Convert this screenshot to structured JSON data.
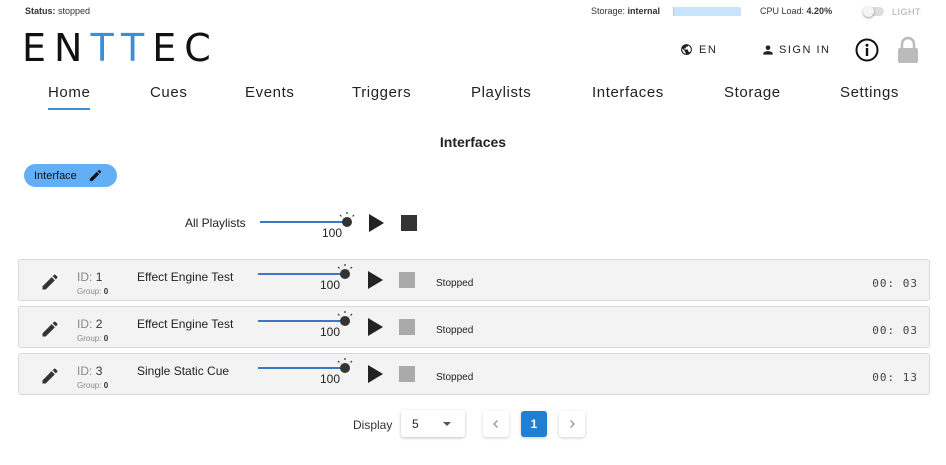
{
  "topbar": {
    "status_label": "Status:",
    "status_value": "stopped",
    "storage_label": "Storage:",
    "storage_value": "internal",
    "storage_used_fraction": 0.02,
    "cpu_label": "CPU Load:",
    "cpu_value": "4.20%",
    "theme_label": "LIGHT"
  },
  "header": {
    "logo_part1": "EN",
    "logo_part2": "TT",
    "logo_part3": "EC",
    "lang_label": "EN",
    "signin_label": "SIGN IN",
    "icons": [
      "globe-icon",
      "person-icon",
      "info-icon",
      "lock-icon"
    ]
  },
  "nav": {
    "tabs": [
      {
        "label": "Home",
        "active": true
      },
      {
        "label": "Cues"
      },
      {
        "label": "Events"
      },
      {
        "label": "Triggers"
      },
      {
        "label": "Playlists"
      },
      {
        "label": "Interfaces"
      },
      {
        "label": "Storage"
      },
      {
        "label": "Settings"
      }
    ]
  },
  "main": {
    "title": "Interfaces",
    "chip_label": "Interface",
    "all_playlists": {
      "label": "All Playlists",
      "value": "100"
    }
  },
  "cues": [
    {
      "id_label": "ID:",
      "id": "1",
      "group_label": "Group:",
      "group": "0",
      "name": "Effect Engine Test",
      "value": "100",
      "state": "Stopped",
      "time": "00: 03"
    },
    {
      "id_label": "ID:",
      "id": "2",
      "group_label": "Group:",
      "group": "0",
      "name": "Effect Engine Test",
      "value": "100",
      "state": "Stopped",
      "time": "00: 03"
    },
    {
      "id_label": "ID:",
      "id": "3",
      "group_label": "Group:",
      "group": "0",
      "name": "Single Static Cue",
      "value": "100",
      "state": "Stopped",
      "time": "00: 13"
    }
  ],
  "pagination": {
    "display_label": "Display",
    "page_size": "5",
    "current_page": "1",
    "prev_icon": "chevron-left-icon",
    "next_icon": "chevron-right-icon"
  },
  "colors": {
    "accent": "#3b8fd6",
    "chip": "#64aef5",
    "current_page": "#1f7fd0"
  }
}
